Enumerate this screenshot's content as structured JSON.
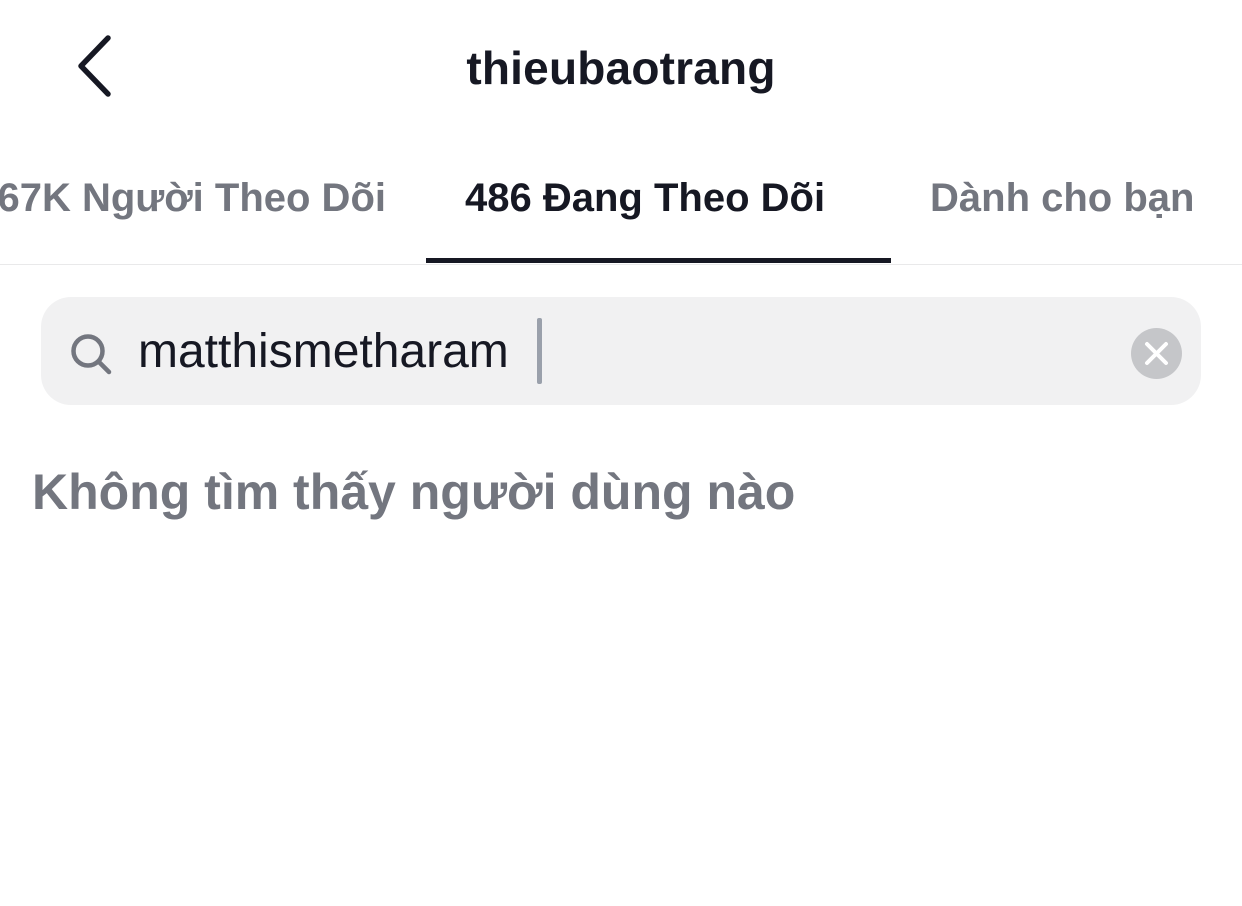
{
  "header": {
    "title": "thieubaotrang",
    "back_icon": "chevron-left-icon"
  },
  "tabs": [
    {
      "label": "67K Người Theo Dõi",
      "active": false
    },
    {
      "label": "486 Đang Theo Dõi",
      "active": true
    },
    {
      "label": "Dành cho bạn",
      "active": false
    }
  ],
  "search": {
    "value": "matthismetharam",
    "icon": "search-icon",
    "clear_icon": "clear-icon"
  },
  "results": {
    "empty_message": "Không tìm thấy người dùng nào"
  },
  "colors": {
    "text_primary": "#161823",
    "text_secondary": "#73767f",
    "search_bg": "#f1f1f2",
    "clear_button_bg": "#c5c6c9",
    "caret": "#9aa0ab"
  }
}
